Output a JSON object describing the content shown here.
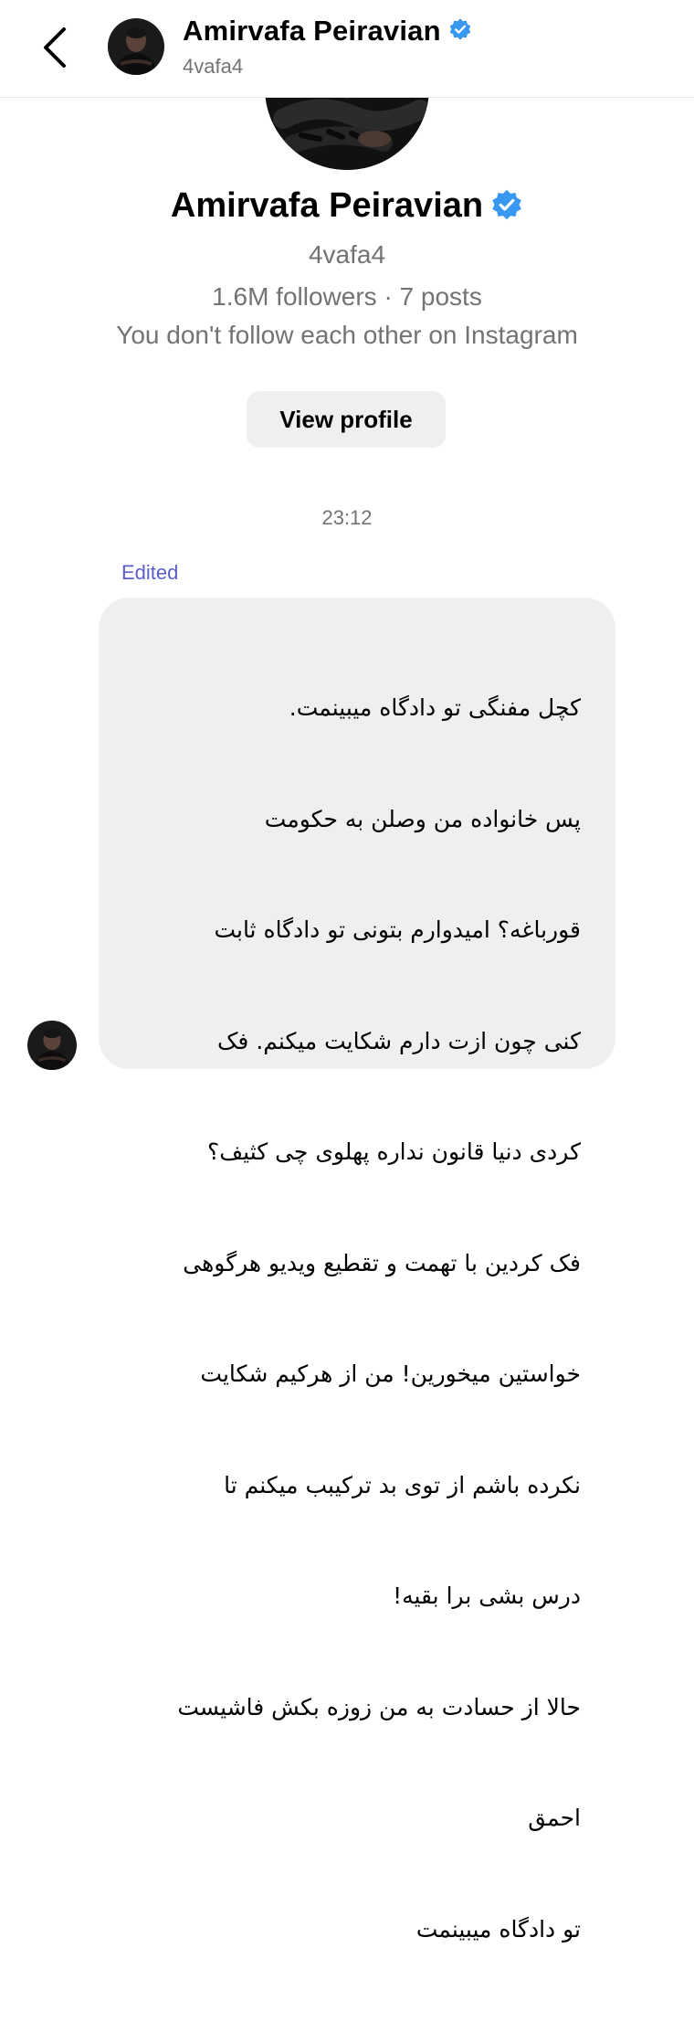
{
  "header": {
    "name": "Amirvafa Peiravian",
    "handle": "4vafa4",
    "back_icon": "chevron-left-icon",
    "verified_icon": "verified-badge-icon"
  },
  "profile": {
    "name": "Amirvafa Peiravian",
    "handle": "4vafa4",
    "stats": "1.6M followers · 7 posts",
    "follow_status": "You don't follow each other on Instagram",
    "view_profile_label": "View profile"
  },
  "chat": {
    "timestamp": "23:12",
    "edited_label": "Edited",
    "message_lines": [
      "کچل مفنگی تو دادگاه میبینمت.",
      "پس خانواده من وصلن به حکومت",
      "قورباغه؟  امیدوارم بتونی تو دادگاه ثابت",
      "کنی چون ازت دارم شکایت میکنم. فک",
      "کردی دنیا قانون نداره پهلوی چی کثیف؟",
      "فک کردین با تهمت و تقطیع ویدیو هرگوهی",
      "خواستین میخورین! من از هرکیم شکایت",
      "نکرده باشم از توی بد ترکیبب میکنم تا",
      "درس بشی برا بقیه!",
      "حالا از حسادت به من زوزه بکش فاشیست",
      "احمق",
      "تو دادگاه میبینمت"
    ]
  },
  "colors": {
    "verified_blue": "#3897f0",
    "edited_purple": "#5b5fc7",
    "bubble_bg": "#efeff1",
    "secondary_text": "#737373"
  }
}
